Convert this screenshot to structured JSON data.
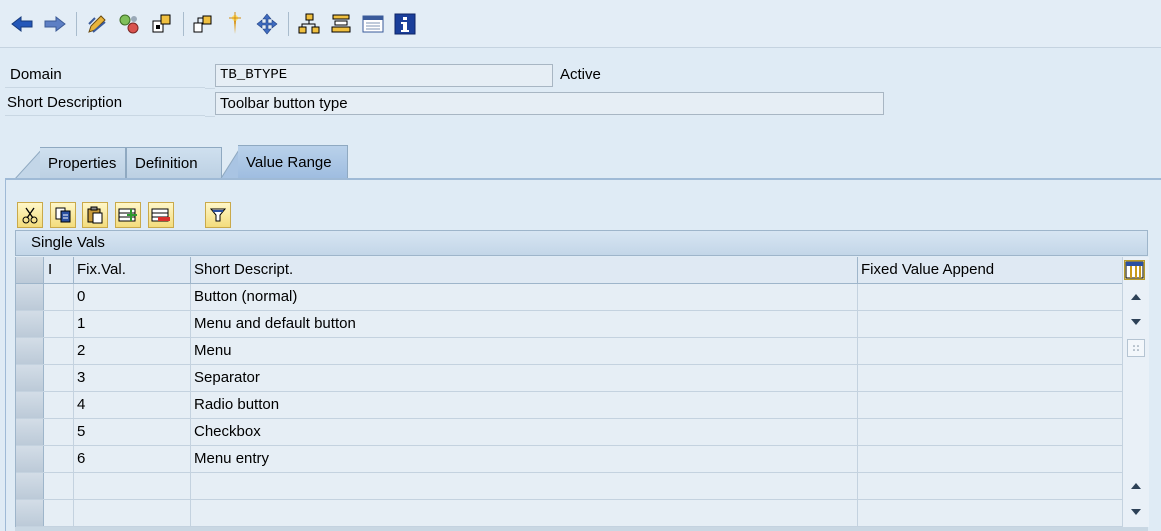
{
  "toolbar": {
    "icons": [
      "back-icon",
      "forward-icon",
      "edit-icon",
      "activate-icon",
      "where-used-icon",
      "object-list-icon",
      "display-object-icon",
      "navigate-icon",
      "hierarchy-icon",
      "stack-icon",
      "layout-icon",
      "info-icon"
    ]
  },
  "header": {
    "domain_label": "Domain",
    "domain_value": "TB_BTYPE",
    "status": "Active",
    "short_desc_label": "Short Description",
    "short_desc_value": "Toolbar button type"
  },
  "tabs": [
    {
      "label": "Properties"
    },
    {
      "label": "Definition"
    },
    {
      "label": "Value Range",
      "active": true
    }
  ],
  "table": {
    "title": "Single Vals",
    "columns": {
      "indicator": "I",
      "fix_val": "Fix.Val.",
      "short_descript": "Short Descript.",
      "append": "Fixed Value Append"
    },
    "rows": [
      {
        "fix": "0",
        "desc": "Button (normal)"
      },
      {
        "fix": "1",
        "desc": "Menu and default button"
      },
      {
        "fix": "2",
        "desc": "Menu"
      },
      {
        "fix": "3",
        "desc": "Separator"
      },
      {
        "fix": "4",
        "desc": "Radio button"
      },
      {
        "fix": "5",
        "desc": "Checkbox"
      },
      {
        "fix": "6",
        "desc": "Menu entry"
      },
      {
        "fix": "",
        "desc": ""
      },
      {
        "fix": "",
        "desc": ""
      }
    ]
  },
  "colors": {
    "accent": "#1f4f9a",
    "panel": "#dfebf5"
  }
}
